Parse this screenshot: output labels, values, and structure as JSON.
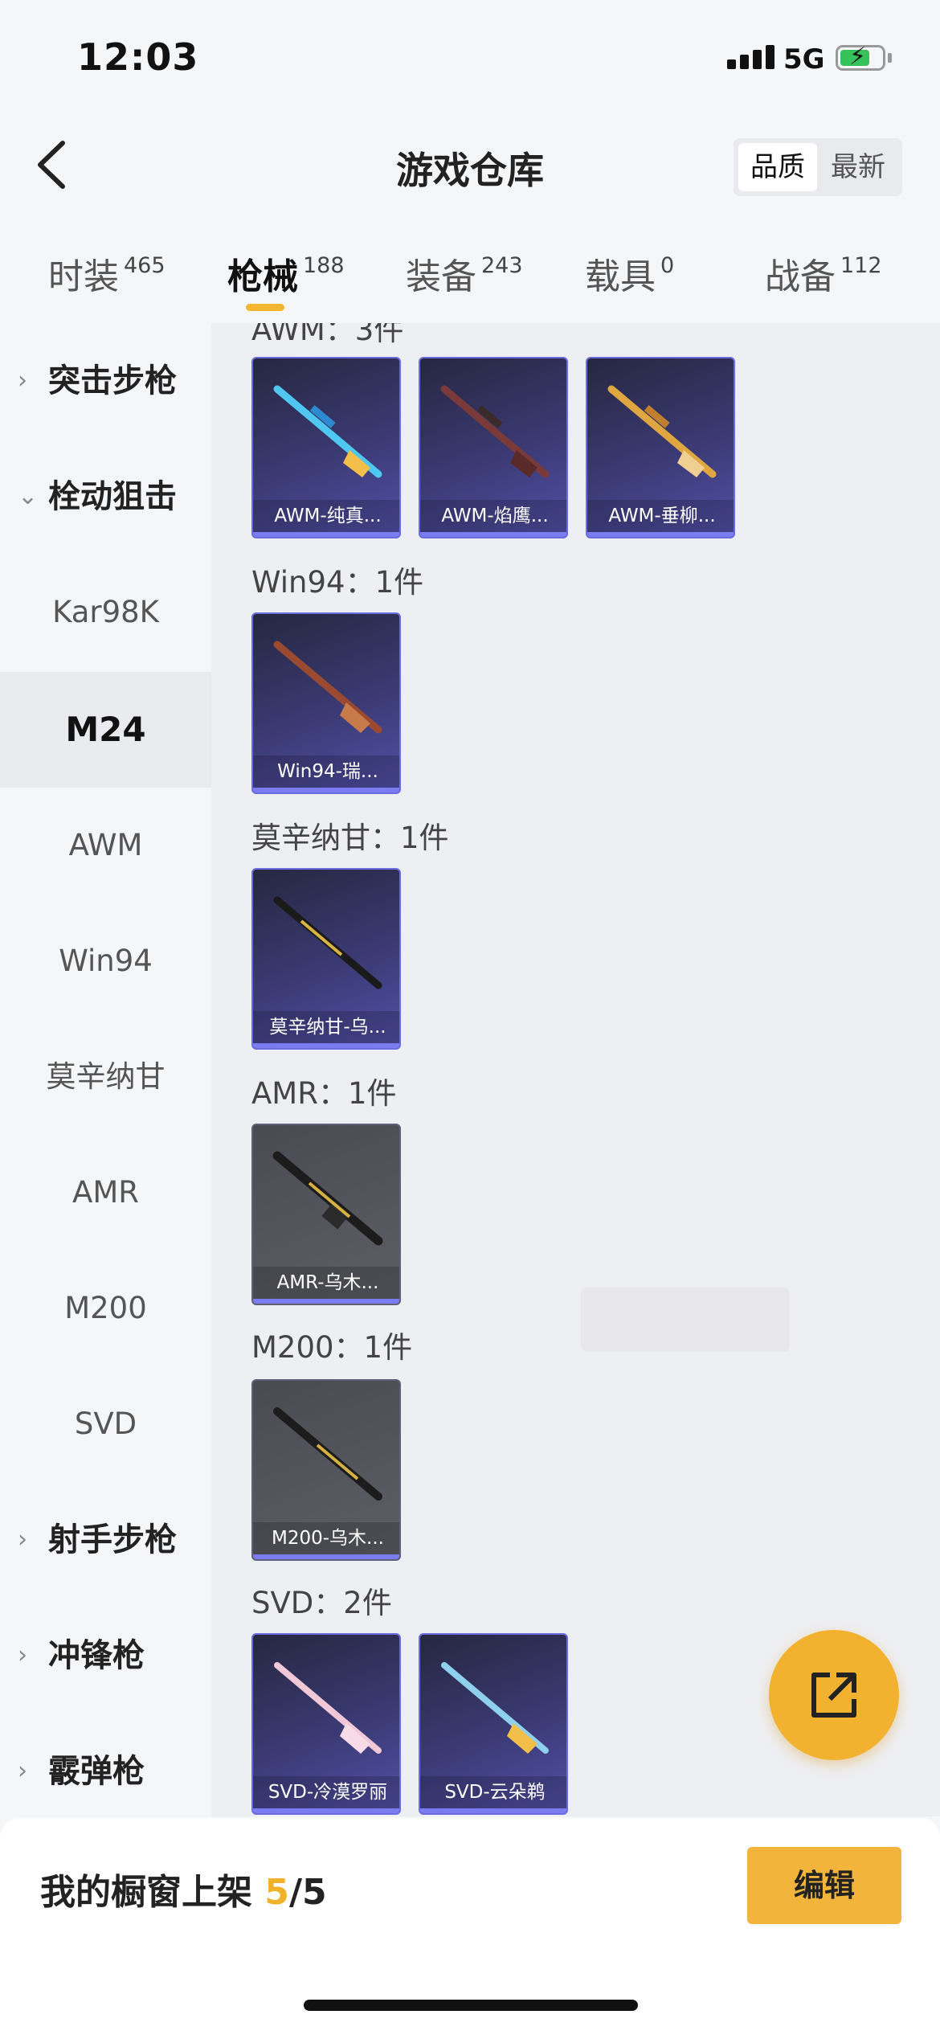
{
  "status": {
    "time": "12:03",
    "network": "5G"
  },
  "header": {
    "title": "游戏仓库",
    "sort_options": [
      "品质",
      "最新"
    ]
  },
  "tabs": [
    {
      "label": "时装",
      "count": "465"
    },
    {
      "label": "枪械",
      "count": "188"
    },
    {
      "label": "装备",
      "count": "243"
    },
    {
      "label": "载具",
      "count": "0"
    },
    {
      "label": "战备",
      "count": "112"
    }
  ],
  "sidebar": {
    "items": [
      {
        "label": "突击步枪",
        "type": "category",
        "expanded": false
      },
      {
        "label": "栓动狙击",
        "type": "category",
        "expanded": true
      },
      {
        "label": "Kar98K",
        "type": "sub"
      },
      {
        "label": "M24",
        "type": "sub",
        "selected": true
      },
      {
        "label": "AWM",
        "type": "sub"
      },
      {
        "label": "Win94",
        "type": "sub"
      },
      {
        "label": "莫辛纳甘",
        "type": "sub"
      },
      {
        "label": "AMR",
        "type": "sub"
      },
      {
        "label": "M200",
        "type": "sub"
      },
      {
        "label": "SVD",
        "type": "sub"
      },
      {
        "label": "射手步枪",
        "type": "category",
        "expanded": false
      },
      {
        "label": "冲锋枪",
        "type": "category",
        "expanded": false
      },
      {
        "label": "霰弹枪",
        "type": "category",
        "expanded": false
      }
    ]
  },
  "sections": [
    {
      "title": "AWM：3件",
      "items": [
        "AWM-纯真...",
        "AWM-焰鹰...",
        "AWM-垂柳..."
      ]
    },
    {
      "title": "Win94：1件",
      "items": [
        "Win94-瑞..."
      ]
    },
    {
      "title": "莫辛纳甘：1件",
      "items": [
        "莫辛纳甘-乌..."
      ]
    },
    {
      "title": "AMR：1件",
      "items": [
        "AMR-乌木..."
      ]
    },
    {
      "title": "M200：1件",
      "items": [
        "M200-乌木..."
      ]
    },
    {
      "title": "SVD：2件",
      "items": [
        "SVD-冷漠罗丽",
        "SVD-云朵鹈"
      ]
    }
  ],
  "bottom": {
    "showcase_label": "我的橱窗上架",
    "showcase_count": "5",
    "showcase_total": "/5",
    "edit_label": "编辑"
  },
  "colors": {
    "accent": "#f2b43a",
    "card_border": "#6b6ce0",
    "selected_bg": "#eaebef"
  }
}
